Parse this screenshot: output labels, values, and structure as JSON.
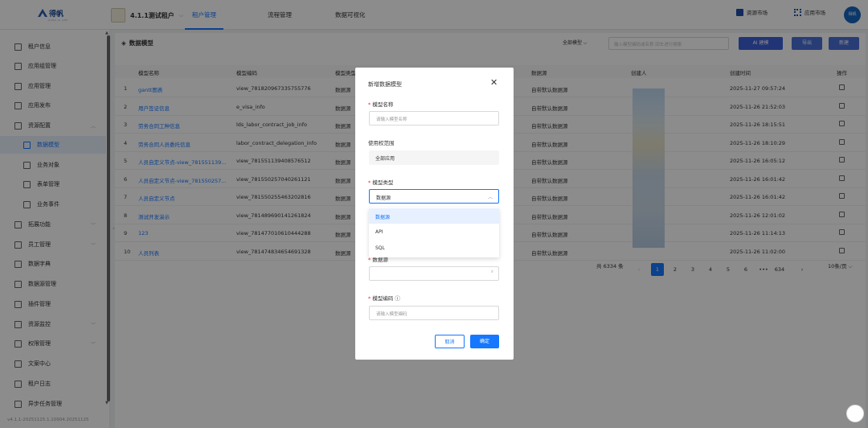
{
  "logo": {
    "name": "得帆",
    "sub": "AURA AI APP"
  },
  "tenant": {
    "name": "4.1.1测试租户"
  },
  "nav": {
    "tabs": [
      "租户管理",
      "流程管理",
      "数据可视化"
    ]
  },
  "topright": {
    "resource_market": "资源市场",
    "app_market": "应用市场",
    "avatar": "得帆"
  },
  "sidebar": {
    "items": [
      {
        "label": "租户信息"
      },
      {
        "label": "应用组管理"
      },
      {
        "label": "应用管理"
      },
      {
        "label": "应用发布"
      },
      {
        "label": "资源配置"
      },
      {
        "label": "数据模型"
      },
      {
        "label": "业务对象"
      },
      {
        "label": "表单管理"
      },
      {
        "label": "业务事件"
      },
      {
        "label": "拓展功能"
      },
      {
        "label": "员工管理"
      },
      {
        "label": "数据字典"
      },
      {
        "label": "数据源管理"
      },
      {
        "label": "插件管理"
      },
      {
        "label": "资源监控"
      },
      {
        "label": "权限管理"
      },
      {
        "label": "文案中心"
      },
      {
        "label": "租户日志"
      },
      {
        "label": "异步任务管理"
      }
    ],
    "version": "v4.1.1-20251125.1.10904.20251125"
  },
  "main": {
    "title": "数据模型",
    "filter": "全部模型",
    "search_placeholder": "输入模型编码或名称 回车进行搜索",
    "ai_button": "AI 建模",
    "export_button": "导出",
    "new_button": "新建",
    "columns": [
      "模型名称",
      "模型编码",
      "模型类型",
      "数据源",
      "创建人",
      "创建时间",
      "操作"
    ],
    "rows": [
      {
        "no": "1",
        "name": "gantt图表",
        "code": "view_781820967335755776",
        "type": "数据源",
        "ds": "自带默认数据源",
        "time": "2025-11-27 09:57:24"
      },
      {
        "no": "2",
        "name": "用户签证信息",
        "code": "e_visa_info",
        "type": "数据源",
        "ds": "自带默认数据源",
        "time": "2025-11-26 21:52:03"
      },
      {
        "no": "3",
        "name": "劳务合同工种信息",
        "code": "lds_labor_contract_job_info",
        "type": "数据源",
        "ds": "自带默认数据源",
        "time": "2025-11-26 18:15:51"
      },
      {
        "no": "4",
        "name": "劳务合同人员委托信息",
        "code": "labor_contract_delegation_info",
        "type": "数据源",
        "ds": "自带默认数据源",
        "time": "2025-11-26 18:10:29"
      },
      {
        "no": "5",
        "name": "人员自定义节点-view_781551139...",
        "code": "view_781551139408576512",
        "type": "数据源",
        "ds": "自带默认数据源",
        "time": "2025-11-26 16:05:12"
      },
      {
        "no": "6",
        "name": "人员自定义节点-view_781550257...",
        "code": "view_781550257040261121",
        "type": "数据源",
        "ds": "自带默认数据源",
        "time": "2025-11-26 16:01:42"
      },
      {
        "no": "7",
        "name": "人员自定义节点",
        "code": "view_781550255463202816",
        "type": "数据源",
        "ds": "自带默认数据源",
        "time": "2025-11-26 16:01:42"
      },
      {
        "no": "8",
        "name": "测试开发演示",
        "code": "view_781489690141261824",
        "type": "数据源",
        "ds": "自带默认数据源",
        "time": "2025-11-26 12:01:02"
      },
      {
        "no": "9",
        "name": "123",
        "code": "view_781477010610444288",
        "type": "数据源",
        "ds": "自带默认数据源",
        "time": "2025-11-26 11:14:13"
      },
      {
        "no": "10",
        "name": "人员列表",
        "code": "view_781474834654691328",
        "type": "数据源",
        "ds": "自带默认数据源",
        "time": "2025-11-26 11:02:00"
      }
    ],
    "pagination": {
      "total": "共 6334 条",
      "pages": [
        "1",
        "2",
        "3",
        "4",
        "5",
        "6",
        "•••",
        "634"
      ],
      "page_size": "10条/页"
    }
  },
  "modal": {
    "title": "新增数据模型",
    "name_label": "模型名称",
    "name_placeholder": "请输入模型名称",
    "scope_label": "使用权范围",
    "scope_value": "全部应用",
    "type_label": "模型类型",
    "type_value": "数据源",
    "type_options": [
      "数据源",
      "API",
      "SQL"
    ],
    "ds_label": "数据源",
    "code_label": "模型编码",
    "code_placeholder": "请输入模型编码",
    "cancel": "取消",
    "confirm": "确定"
  }
}
